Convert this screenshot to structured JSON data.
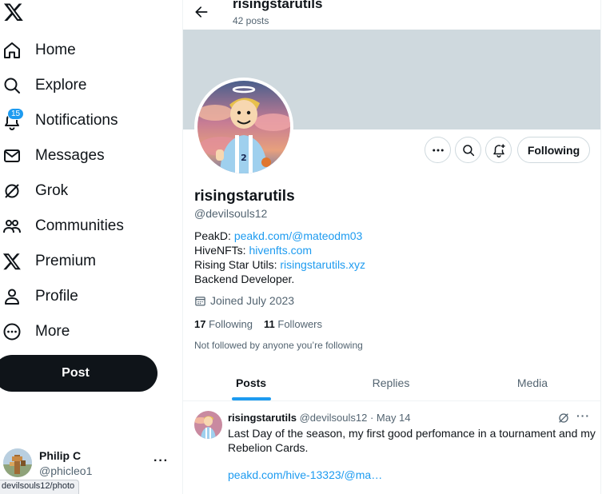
{
  "sidebar": {
    "logo": "x-logo-icon",
    "items": [
      {
        "label": "Home",
        "icon": "home-icon"
      },
      {
        "label": "Explore",
        "icon": "search-icon"
      },
      {
        "label": "Notifications",
        "icon": "bell-icon",
        "badge": "15"
      },
      {
        "label": "Messages",
        "icon": "envelope-icon"
      },
      {
        "label": "Grok",
        "icon": "grok-icon"
      },
      {
        "label": "Communities",
        "icon": "people-icon"
      },
      {
        "label": "Premium",
        "icon": "x-logo-icon"
      },
      {
        "label": "Profile",
        "icon": "person-icon"
      },
      {
        "label": "More",
        "icon": "more-circle-icon"
      }
    ],
    "post_label": "Post",
    "account": {
      "name": "Philip C",
      "handle": "@phicleo1",
      "more": "···"
    }
  },
  "status_url": "devilsouls12/photo",
  "header": {
    "title": "risingstarutils",
    "subtitle": "42 posts"
  },
  "profile": {
    "display_name": "risingstarutils",
    "handle": "@devilsouls12",
    "actions": {
      "more": "more-icon",
      "search": "search-icon",
      "notify": "bell-plus-icon",
      "following_label": "Following"
    },
    "bio": [
      {
        "prefix": "PeakD: ",
        "link": "peakd.com/@mateodm03"
      },
      {
        "prefix": "HiveNFTs: ",
        "link": "hivenfts.com"
      },
      {
        "prefix": "Rising Star Utils: ",
        "link": "risingstarutils.xyz"
      },
      {
        "prefix": "Backend Developer.",
        "link": ""
      }
    ],
    "joined": "Joined July 2023",
    "following_count": "17",
    "following_label": "Following",
    "followers_count": "11",
    "followers_label": "Followers",
    "not_followed": "Not followed by anyone you’re following"
  },
  "tabs": [
    "Posts",
    "Replies",
    "Media"
  ],
  "active_tab": "Posts",
  "tweet": {
    "name": "risingstarutils",
    "meta": "@devilsouls12 · May 14",
    "text": "Last Day of the season, my first good perfomance in a tournament and my Rebelion Cards.",
    "link": "peakd.com/hive-13323/@ma…"
  },
  "colors": {
    "accent": "#1d9bf0",
    "text": "#0f1419",
    "muted": "#536471",
    "banner": "#cfd9de"
  }
}
